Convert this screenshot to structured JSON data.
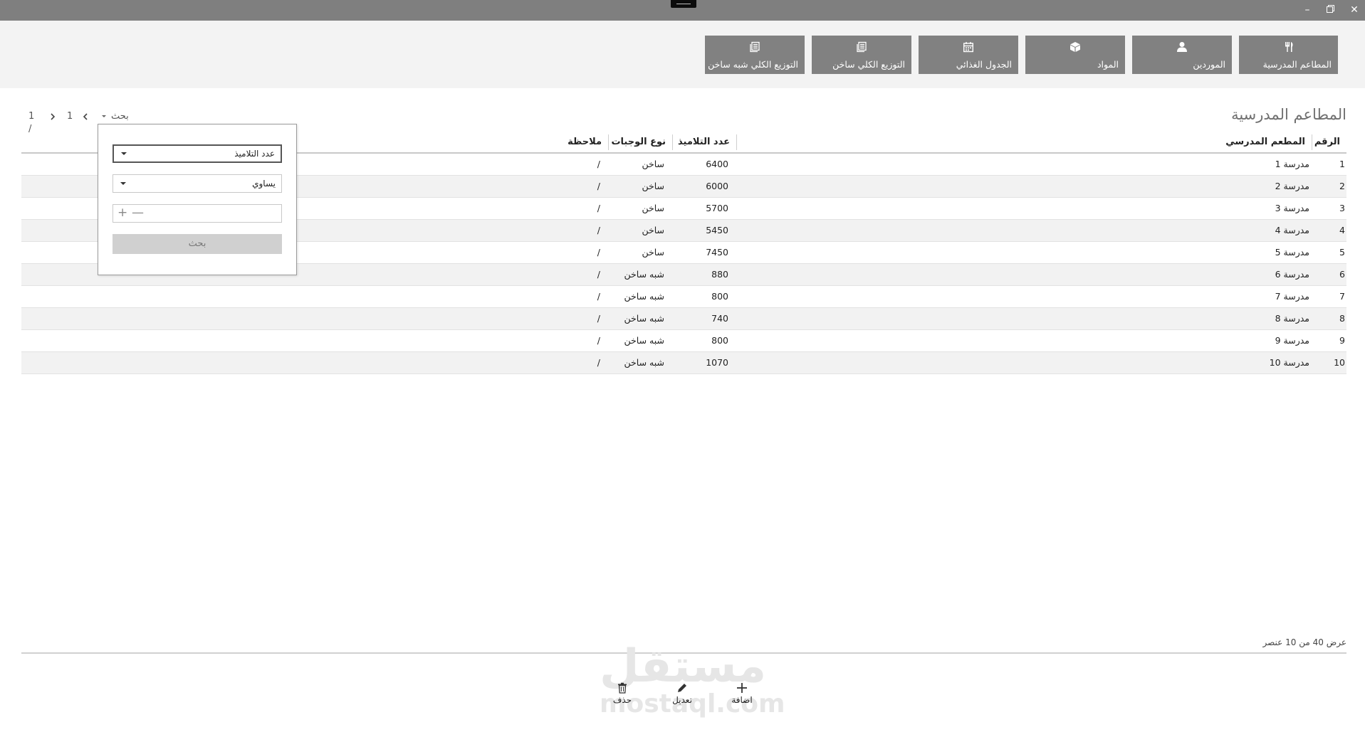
{
  "window": {
    "minimize_icon": "minimize-icon",
    "restore_icon": "restore-icon",
    "close_icon": "close-icon"
  },
  "nav": {
    "tiles": [
      {
        "label": "المطاعم المدرسية",
        "icon": "fork-knife-icon"
      },
      {
        "label": "الموردين",
        "icon": "person-icon"
      },
      {
        "label": "المواد",
        "icon": "box-icon"
      },
      {
        "label": "الجدول الغذائي",
        "icon": "calendar-icon"
      },
      {
        "label": "التوزيع الكلي ساخن",
        "icon": "document-icon"
      },
      {
        "label": "التوزيع الكلي شبه ساخن",
        "icon": "document-icon"
      }
    ]
  },
  "page": {
    "title": "المطاعم المدرسية"
  },
  "pager": {
    "search_label": "بحث",
    "current_page": "1",
    "total": "1 /"
  },
  "table": {
    "headers": {
      "id": "الرقم",
      "restaurant": "المطعم المدرسي",
      "students": "عدد التلاميذ",
      "meal_type": "نوع الوجبات",
      "note": "ملاحظة"
    },
    "rows": [
      {
        "id": "1",
        "restaurant": "مدرسة 1",
        "students": "6400",
        "meal_type": "ساخن",
        "note": "/"
      },
      {
        "id": "2",
        "restaurant": "مدرسة 2",
        "students": "6000",
        "meal_type": "ساخن",
        "note": "/"
      },
      {
        "id": "3",
        "restaurant": "مدرسة 3",
        "students": "5700",
        "meal_type": "ساخن",
        "note": "/"
      },
      {
        "id": "4",
        "restaurant": "مدرسة 4",
        "students": "5450",
        "meal_type": "ساخن",
        "note": "/"
      },
      {
        "id": "5",
        "restaurant": "مدرسة 5",
        "students": "7450",
        "meal_type": "ساخن",
        "note": "/"
      },
      {
        "id": "6",
        "restaurant": "مدرسة 6",
        "students": "880",
        "meal_type": "شبه ساخن",
        "note": "/"
      },
      {
        "id": "7",
        "restaurant": "مدرسة 7",
        "students": "800",
        "meal_type": "شبه ساخن",
        "note": "/"
      },
      {
        "id": "8",
        "restaurant": "مدرسة 8",
        "students": "740",
        "meal_type": "شبه ساخن",
        "note": "/"
      },
      {
        "id": "9",
        "restaurant": "مدرسة 9",
        "students": "800",
        "meal_type": "شبه ساخن",
        "note": "/"
      },
      {
        "id": "10",
        "restaurant": "مدرسة 10",
        "students": "1070",
        "meal_type": "شبه ساخن",
        "note": "/"
      }
    ]
  },
  "filter": {
    "field_value": "عدد التلاميذ",
    "operator_value": "يساوي",
    "number_value": "",
    "search_button": "بحث"
  },
  "footer": {
    "show_label": "عرض",
    "page_size": "40",
    "of_label": "من",
    "count": "10",
    "items_label": "عنصر"
  },
  "actions": {
    "add": "اضافة",
    "edit": "تعديل",
    "delete": "حذف"
  },
  "watermark": {
    "arabic": "مستقل",
    "latin": "mostaql.com"
  }
}
